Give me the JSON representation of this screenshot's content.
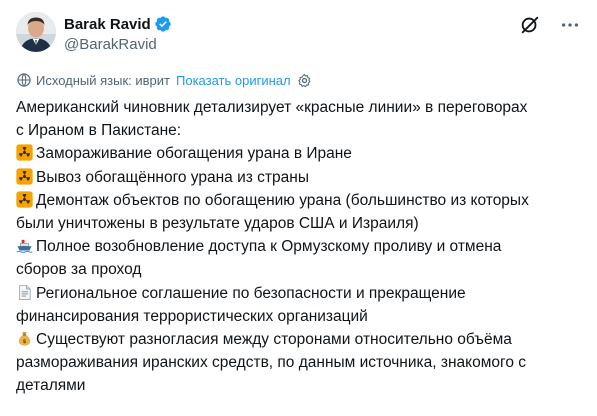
{
  "author": {
    "display_name": "Barak Ravid",
    "handle": "@BarakRavid"
  },
  "icons": {
    "verified": "verified-badge-icon",
    "grok": "grok-icon",
    "more": "more-icon",
    "translate": "translate-icon",
    "settings": "settings-icon",
    "radioactive": "radioactive-icon",
    "ship": "ship-icon",
    "document": "document-icon",
    "money_bag": "money-bag-icon"
  },
  "colors": {
    "accent": "#1d9bf0",
    "text": "#0f1419",
    "secondary": "#536471",
    "radioactive": "#f4a300"
  },
  "translation": {
    "source_label": "Исходный язык: иврит",
    "show_original": "Показать оригинал"
  },
  "tweet": {
    "intro_line1": "Американский чиновник детализирует «красные линии» в переговорах",
    "intro_line2": "с Ираном в Пакистане:",
    "item1": "Замораживание обогащения урана в Иране",
    "item2": "Вывоз обогащённого урана из страны",
    "item3_line1": "Демонтаж объектов по обогащению урана (большинство из которых",
    "item3_line2": "были уничтожены в результате ударов США и Израиля)",
    "item4_line1": "Полное возобновление доступа к Ормузскому проливу и отмена",
    "item4_line2": "сборов за проход",
    "item5_line1": "Региональное соглашение по безопасности и прекращение",
    "item5_line2": "финансирования террористических организаций",
    "item6_line1": "Существуют разногласия между сторонами относительно объёма",
    "item6_line2": "размораживания иранских средств, по данным источника, знакомого с",
    "item6_line3": "деталями"
  }
}
